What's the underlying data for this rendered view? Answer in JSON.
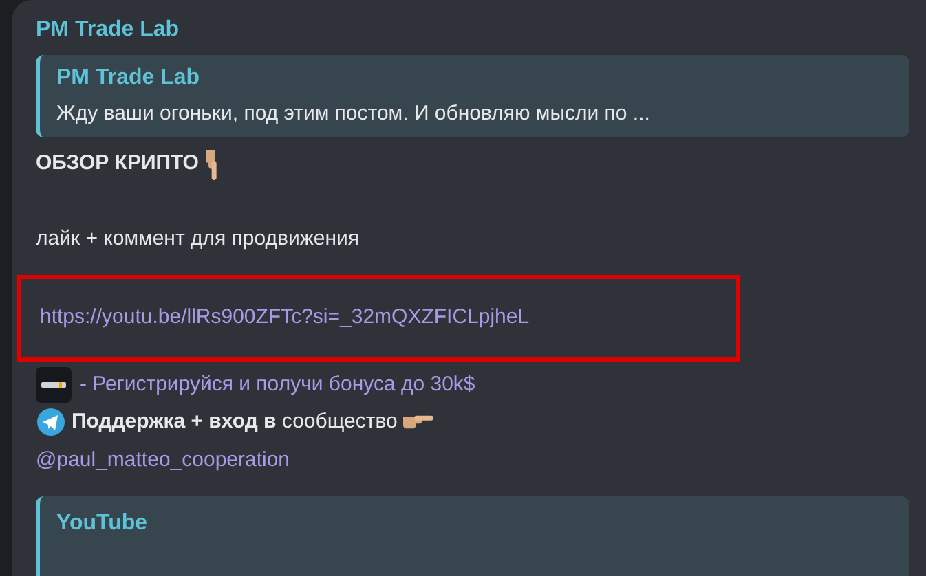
{
  "channel_name": "PM Trade Lab",
  "reply": {
    "author": "PM Trade Lab",
    "text": "Жду ваши огоньки, под этим постом. И обновляю мысли по ..."
  },
  "heading": "ОБЗОР КРИПТО",
  "call_to_action": "лайк + коммент для продвижения",
  "link": {
    "url": "https://youtu.be/llRs900ZFTc?si=_32mQXZFICLpjheL",
    "highlighted": true
  },
  "promo": "- Регистрируйся и получи бонуса до 30k$",
  "support": "**Поддержка + вход в** сообщество",
  "handle": "@paul_matteo_cooperation",
  "link_preview": {
    "site": "YouTube"
  }
}
